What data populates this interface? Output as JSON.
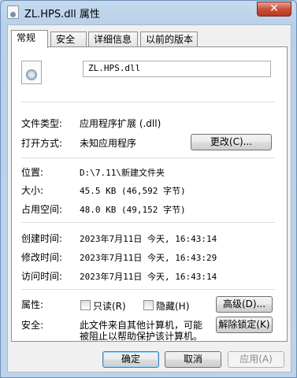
{
  "window": {
    "title": "ZL.HPS.dll 属性",
    "close_glyph": "✕"
  },
  "tabs": [
    "常规",
    "安全",
    "详细信息",
    "以前的版本"
  ],
  "general": {
    "file_name": "ZL.HPS.dll",
    "file_type_label": "文件类型:",
    "file_type_value": "应用程序扩展 (.dll)",
    "open_with_label": "打开方式:",
    "open_with_value": "未知应用程序",
    "change_button": "更改(C)...",
    "location_label": "位置:",
    "location_value": "D:\\7.11\\新建文件夹",
    "size_label": "大小:",
    "size_value": "45.5 KB (46,592 字节)",
    "size_on_disk_label": "占用空间:",
    "size_on_disk_value": "48.0 KB (49,152 字节)",
    "created_label": "创建时间:",
    "created_value": "2023年7月11日 今天, 16:43:14",
    "modified_label": "修改时间:",
    "modified_value": "2023年7月11日 今天, 16:43:29",
    "accessed_label": "访问时间:",
    "accessed_value": "2023年7月11日 今天, 16:43:14",
    "attributes_label": "属性:",
    "readonly_label": "只读(R)",
    "readonly_checked": false,
    "hidden_label": "隐藏(H)",
    "hidden_checked": false,
    "advanced_button": "高级(D)...",
    "security_label": "安全:",
    "security_text_line1": "此文件来自其他计算机，可能",
    "security_text_line2": "被阻止以帮助保护该计算机。",
    "unblock_button": "解除锁定(K)"
  },
  "footer": {
    "ok": "确定",
    "cancel": "取消",
    "apply": "应用(A)"
  }
}
